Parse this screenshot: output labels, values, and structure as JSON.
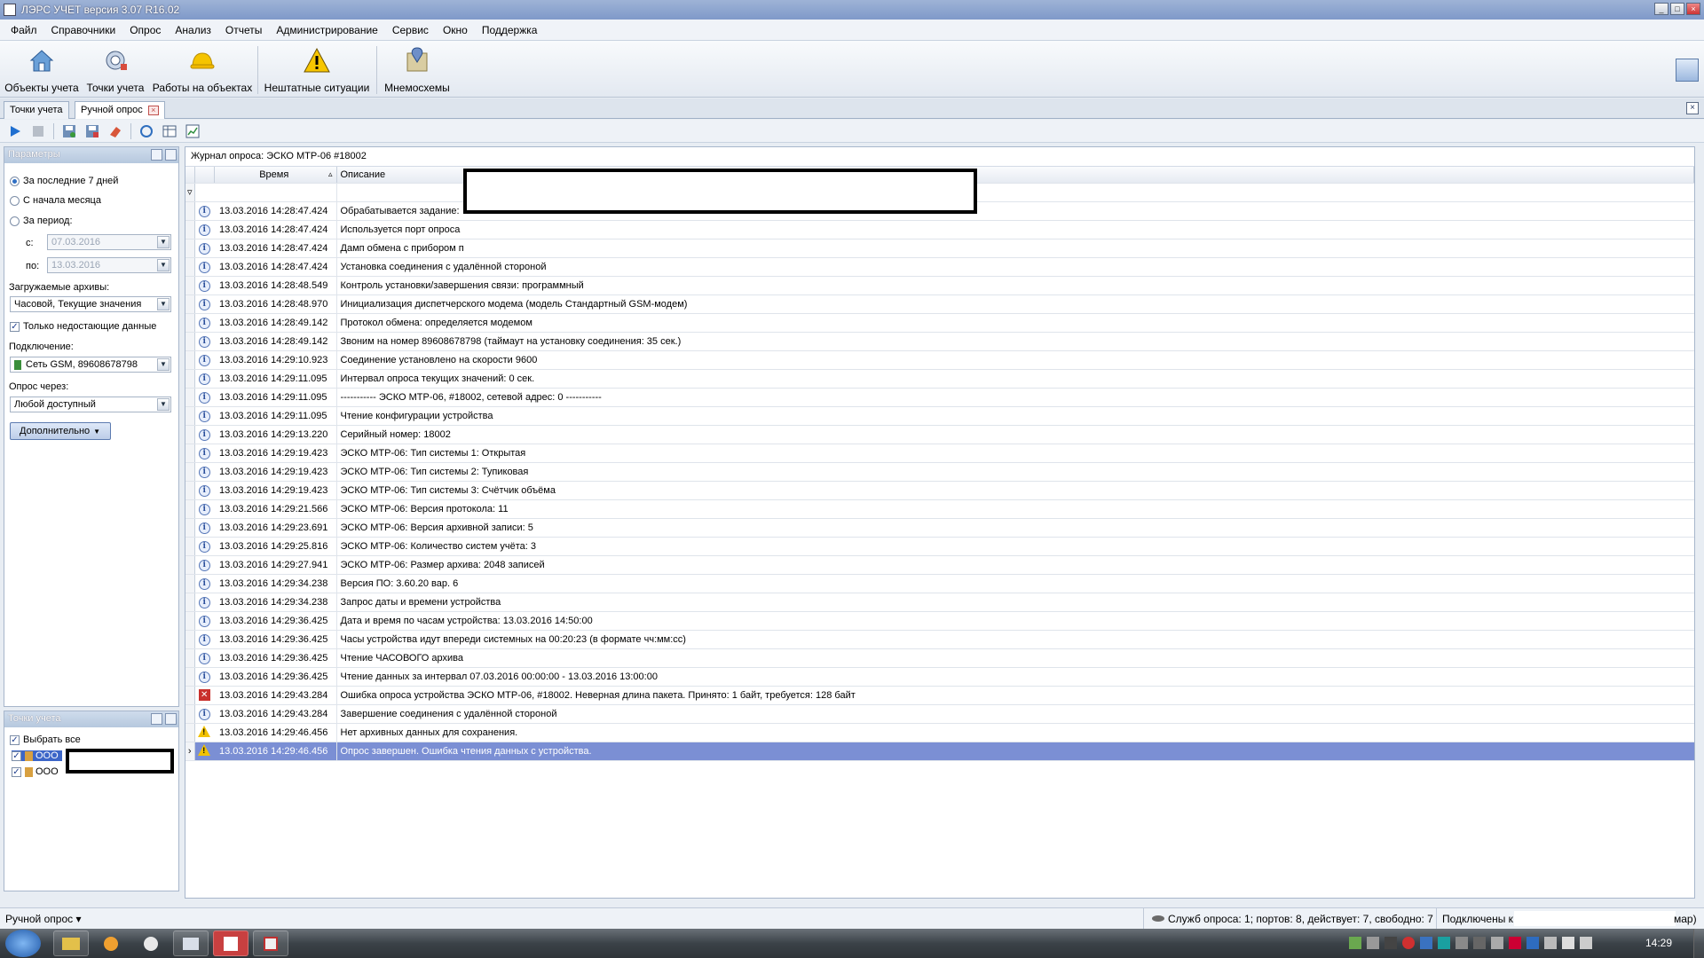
{
  "window": {
    "title": "ЛЭРС УЧЕТ версия 3.07 R16.02",
    "btn_min": "_",
    "btn_max": "□",
    "btn_close": "×"
  },
  "menu": [
    "Файл",
    "Справочники",
    "Опрос",
    "Анализ",
    "Отчеты",
    "Администрирование",
    "Сервис",
    "Окно",
    "Поддержка"
  ],
  "ribbon": {
    "objects": "Объекты учета",
    "points": "Точки учета",
    "works": "Работы на объектах",
    "emergency": "Нештатные ситуации",
    "diagrams": "Мнемосхемы"
  },
  "doc_tabs": {
    "tab1": "Точки учета",
    "tab2": "Ручной опрос",
    "close_glyph": "×"
  },
  "params": {
    "header": "Параметры",
    "opt_last7": "За последние 7 дней",
    "opt_month": "С начала месяца",
    "opt_period": "За период:",
    "from_label": "с:",
    "from_value": "07.03.2016",
    "to_label": "по:",
    "to_value": "13.03.2016",
    "archives_label": "Загружаемые архивы:",
    "archives_value": "Часовой, Текущие значения",
    "only_missing": "Только недостающие данные",
    "connection_label": "Подключение:",
    "connection_value": "Сеть GSM, 89608678798",
    "poll_via_label": "Опрос через:",
    "poll_via_value": "Любой доступный",
    "extra_button": "Дополнительно"
  },
  "points_panel": {
    "header": "Точки учета",
    "select_all": "Выбрать все",
    "items": [
      "ООО",
      "ООО"
    ]
  },
  "journal": {
    "title": "Журнал опроса: ЭСКО МТР-06 #18002",
    "col_time": "Время",
    "col_desc": "Описание",
    "rows": [
      {
        "type": "info",
        "time": "13.03.2016 14:28:47.424",
        "desc": "Обрабатывается задание:"
      },
      {
        "type": "info",
        "time": "13.03.2016 14:28:47.424",
        "desc": "Используется порт опроса"
      },
      {
        "type": "info",
        "time": "13.03.2016 14:28:47.424",
        "desc": "Дамп обмена с прибором п"
      },
      {
        "type": "info",
        "time": "13.03.2016 14:28:47.424",
        "desc": "Установка соединения с удалённой стороной"
      },
      {
        "type": "info",
        "time": "13.03.2016 14:28:48.549",
        "desc": "Контроль установки/завершения связи: программный"
      },
      {
        "type": "info",
        "time": "13.03.2016 14:28:48.970",
        "desc": "Инициализация диспетчерского модема (модель Стандартный GSM-модем)"
      },
      {
        "type": "info",
        "time": "13.03.2016 14:28:49.142",
        "desc": "Протокол обмена: определяется модемом"
      },
      {
        "type": "info",
        "time": "13.03.2016 14:28:49.142",
        "desc": "Звоним на номер 89608678798 (таймаут на установку соединения: 35 сек.)"
      },
      {
        "type": "info",
        "time": "13.03.2016 14:29:10.923",
        "desc": "Соединение установлено на скорости 9600"
      },
      {
        "type": "info",
        "time": "13.03.2016 14:29:11.095",
        "desc": "Интервал опроса текущих значений: 0 сек."
      },
      {
        "type": "info",
        "time": "13.03.2016 14:29:11.095",
        "desc": "----------- ЭСКО МТР-06, #18002, сетевой адрес: 0 -----------"
      },
      {
        "type": "info",
        "time": "13.03.2016 14:29:11.095",
        "desc": "Чтение конфигурации устройства"
      },
      {
        "type": "info",
        "time": "13.03.2016 14:29:13.220",
        "desc": "Серийный номер: 18002"
      },
      {
        "type": "info",
        "time": "13.03.2016 14:29:19.423",
        "desc": "ЭСКО МТР-06: Тип системы 1: Открытая"
      },
      {
        "type": "info",
        "time": "13.03.2016 14:29:19.423",
        "desc": "ЭСКО МТР-06: Тип системы 2: Тупиковая"
      },
      {
        "type": "info",
        "time": "13.03.2016 14:29:19.423",
        "desc": "ЭСКО МТР-06: Тип системы 3: Счётчик объёма"
      },
      {
        "type": "info",
        "time": "13.03.2016 14:29:21.566",
        "desc": "ЭСКО МТР-06: Версия протокола: 11"
      },
      {
        "type": "info",
        "time": "13.03.2016 14:29:23.691",
        "desc": "ЭСКО МТР-06: Версия архивной записи: 5"
      },
      {
        "type": "info",
        "time": "13.03.2016 14:29:25.816",
        "desc": "ЭСКО МТР-06: Количество систем учёта: 3"
      },
      {
        "type": "info",
        "time": "13.03.2016 14:29:27.941",
        "desc": "ЭСКО МТР-06: Размер архива: 2048 записей"
      },
      {
        "type": "info",
        "time": "13.03.2016 14:29:34.238",
        "desc": "Версия ПО: 3.60.20 вар. 6"
      },
      {
        "type": "info",
        "time": "13.03.2016 14:29:34.238",
        "desc": "Запрос даты и времени устройства"
      },
      {
        "type": "info",
        "time": "13.03.2016 14:29:36.425",
        "desc": "Дата и время по часам устройства: 13.03.2016 14:50:00"
      },
      {
        "type": "info",
        "time": "13.03.2016 14:29:36.425",
        "desc": "Часы устройства идут впереди системных на 00:20:23 (в формате чч:мм:сс)"
      },
      {
        "type": "info",
        "time": "13.03.2016 14:29:36.425",
        "desc": "Чтение ЧАСОВОГО архива"
      },
      {
        "type": "info",
        "time": "13.03.2016 14:29:36.425",
        "desc": "Чтение данных за интервал 07.03.2016 00:00:00 - 13.03.2016 13:00:00"
      },
      {
        "type": "error",
        "time": "13.03.2016 14:29:43.284",
        "desc": "Ошибка опроса устройства ЭСКО МТР-06, #18002. Неверная длина пакета. Принято: 1 байт, требуется: 128 байт"
      },
      {
        "type": "info",
        "time": "13.03.2016 14:29:43.284",
        "desc": "Завершение соединения с удалённой стороной"
      },
      {
        "type": "warning",
        "time": "13.03.2016 14:29:46.456",
        "desc": "Нет архивных данных для сохранения."
      },
      {
        "type": "warning",
        "time": "13.03.2016 14:29:46.456",
        "desc": "Опрос завершен. Ошибка чтения данных с устройства.",
        "selected": true
      }
    ]
  },
  "status": {
    "mode": "Ручной опрос ▾",
    "service": "Служб опроса: 1; портов: 8, действует: 7, свободно: 7",
    "connected_prefix": "Подключены к",
    "connected_suffix": "мар)"
  },
  "taskbar": {
    "clock": "14:29"
  }
}
